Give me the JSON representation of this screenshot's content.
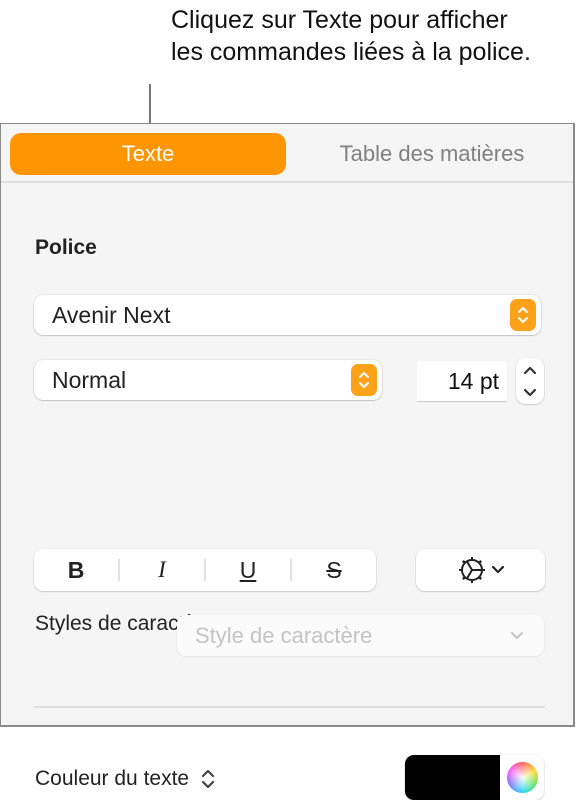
{
  "callout": {
    "text": "Cliquez sur Texte pour afficher les commandes liées à la police."
  },
  "tabs": [
    {
      "label": "Texte",
      "active": true
    },
    {
      "label": "Table des matières",
      "active": false
    }
  ],
  "font_section": {
    "title": "Police",
    "font_family": "Avenir Next",
    "typeface": "Normal",
    "size": "14 pt",
    "style_buttons": [
      {
        "label": "B",
        "name": "bold"
      },
      {
        "label": "I",
        "name": "italic"
      },
      {
        "label": "U",
        "name": "underline"
      },
      {
        "label": "S",
        "name": "strikethrough"
      }
    ],
    "advanced_options_icon": "gear-icon"
  },
  "character_styles": {
    "label": "Styles de caractère",
    "placeholder": "Style de caractère"
  },
  "text_color": {
    "label": "Couleur du texte",
    "value": "#000000"
  },
  "colors": {
    "accent": "#ff9500"
  }
}
